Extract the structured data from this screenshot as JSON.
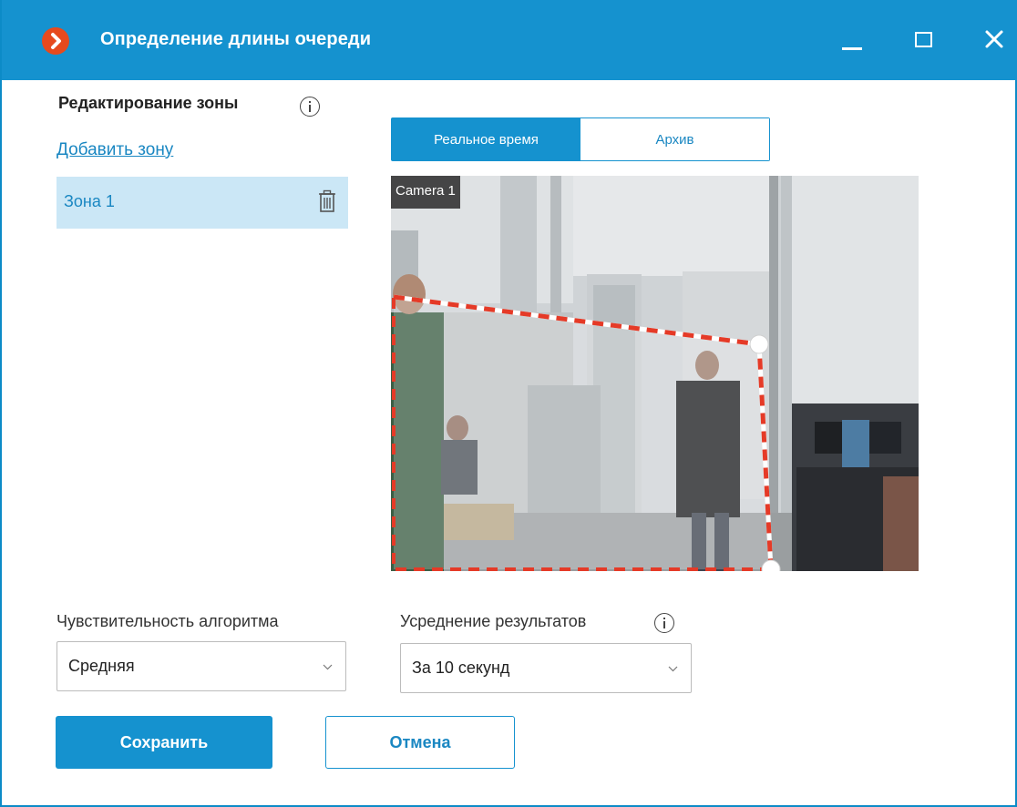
{
  "window": {
    "title": "Определение длины очереди",
    "accent_color": "#1592cf",
    "logo_color": "#e64a1e"
  },
  "zones": {
    "heading": "Редактирование зоны",
    "add_link": "Добавить зону",
    "items": [
      {
        "label": "Зона 1",
        "selected": true
      }
    ]
  },
  "view_tabs": {
    "options": [
      "Реальное время",
      "Архив"
    ],
    "active_index": 0
  },
  "video": {
    "camera_label": "Camera 1",
    "zone_outline_color": "#e53a27"
  },
  "sensitivity": {
    "label": "Чувствительность алгоритма",
    "value": "Средняя"
  },
  "averaging": {
    "label": "Усреднение результатов",
    "value": "За 10 секунд"
  },
  "actions": {
    "save_label": "Сохранить",
    "cancel_label": "Отмена"
  }
}
